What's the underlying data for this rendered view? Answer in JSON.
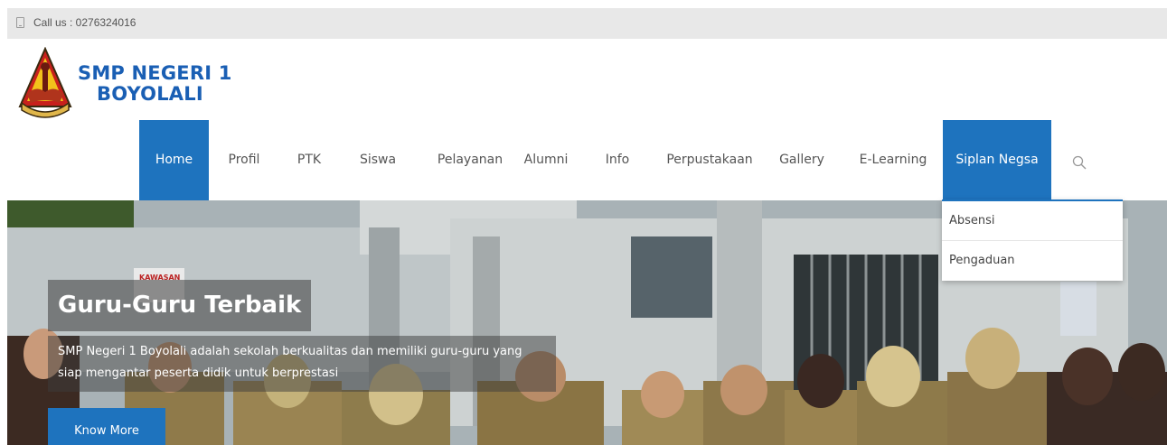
{
  "topbar": {
    "call_text": "Call us : 0276324016"
  },
  "logo": {
    "line1": "SMP NEGERI 1",
    "line2": "BOYOLALI"
  },
  "nav": {
    "items": [
      {
        "label": "Home"
      },
      {
        "label": "Profil"
      },
      {
        "label": "PTK"
      },
      {
        "label": "Siswa"
      },
      {
        "label": "Pelayanan"
      },
      {
        "label": "Alumni"
      },
      {
        "label": "Info"
      },
      {
        "label": "Perpustakaan"
      },
      {
        "label": "Gallery"
      },
      {
        "label": "E-Learning"
      },
      {
        "label": "Siplan Negsa"
      }
    ],
    "active": "Home",
    "highlighted": "Siplan Negsa",
    "search_icon": "search-icon"
  },
  "dropdown": {
    "items": [
      {
        "label": "Absensi"
      },
      {
        "label": "Pengaduan"
      }
    ]
  },
  "hero": {
    "title": "Guru-Guru Terbaik",
    "description": "SMP Negeri 1 Boyolali adalah sekolah berkualitas dan memiliki guru-guru yang siap mengantar peserta didik untuk berprestasi",
    "button": "Know More",
    "sign_text": "KAWASAN"
  },
  "colors": {
    "primary": "#1e73be",
    "logo_text": "#1a5fb4",
    "topbar_bg": "#e8e8e8"
  }
}
